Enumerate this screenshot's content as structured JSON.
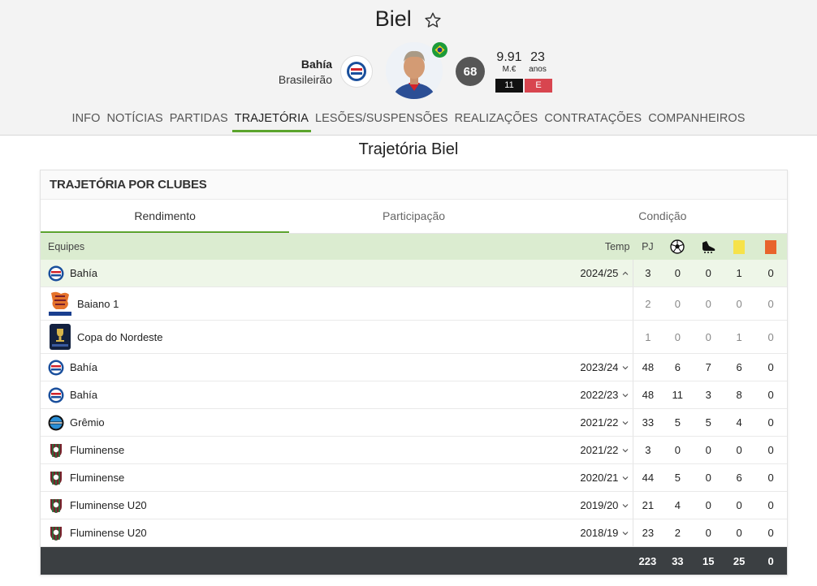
{
  "player": {
    "name": "Biel",
    "team": "Bahía",
    "league": "Brasileirão",
    "rating": "68",
    "value": "9.91",
    "value_unit": "M.€",
    "age": "23",
    "age_unit": "anos",
    "number": "11",
    "shirt_letter": "E"
  },
  "nav": [
    "INFO",
    "NOTÍCIAS",
    "PARTIDAS",
    "TRAJETÓRIA",
    "LESÕES/SUSPENSÕES",
    "REALIZAÇÕES",
    "CONTRATAÇÕES",
    "COMPANHEIROS"
  ],
  "nav_active": 3,
  "section_title": "Trajetória Biel",
  "card_title": "TRAJETÓRIA POR CLUBES",
  "tabs": [
    "Rendimento",
    "Participação",
    "Condição"
  ],
  "headers": {
    "team": "Equipes",
    "season": "Temp",
    "pj": "PJ"
  },
  "rows": [
    {
      "team": "Bahía",
      "season": "2024/25",
      "pj": "3",
      "goals": "0",
      "assists": "0",
      "yellow": "1",
      "red": "0",
      "kind": "club",
      "crest": "bahia",
      "expanded": true
    },
    {
      "team": "Baiano 1",
      "season": "",
      "pj": "2",
      "goals": "0",
      "assists": "0",
      "yellow": "0",
      "red": "0",
      "kind": "comp",
      "crest": "baiano"
    },
    {
      "team": "Copa do Nordeste",
      "season": "",
      "pj": "1",
      "goals": "0",
      "assists": "0",
      "yellow": "1",
      "red": "0",
      "kind": "comp",
      "crest": "nordeste"
    },
    {
      "team": "Bahía",
      "season": "2023/24",
      "pj": "48",
      "goals": "6",
      "assists": "7",
      "yellow": "6",
      "red": "0",
      "kind": "club",
      "crest": "bahia"
    },
    {
      "team": "Bahía",
      "season": "2022/23",
      "pj": "48",
      "goals": "11",
      "assists": "3",
      "yellow": "8",
      "red": "0",
      "kind": "club",
      "crest": "bahia"
    },
    {
      "team": "Grêmio",
      "season": "2021/22",
      "pj": "33",
      "goals": "5",
      "assists": "5",
      "yellow": "4",
      "red": "0",
      "kind": "club",
      "crest": "gremio"
    },
    {
      "team": "Fluminense",
      "season": "2021/22",
      "pj": "3",
      "goals": "0",
      "assists": "0",
      "yellow": "0",
      "red": "0",
      "kind": "club",
      "crest": "fluminense"
    },
    {
      "team": "Fluminense",
      "season": "2020/21",
      "pj": "44",
      "goals": "5",
      "assists": "0",
      "yellow": "6",
      "red": "0",
      "kind": "club",
      "crest": "fluminense"
    },
    {
      "team": "Fluminense U20",
      "season": "2019/20",
      "pj": "21",
      "goals": "4",
      "assists": "0",
      "yellow": "0",
      "red": "0",
      "kind": "club",
      "crest": "fluminense"
    },
    {
      "team": "Fluminense U20",
      "season": "2018/19",
      "pj": "23",
      "goals": "2",
      "assists": "0",
      "yellow": "0",
      "red": "0",
      "kind": "club",
      "crest": "fluminense"
    }
  ],
  "totals": {
    "pj": "223",
    "goals": "33",
    "assists": "15",
    "yellow": "25",
    "red": "0"
  },
  "colors": {
    "accent": "#5ba42c",
    "header_bg": "#dbecd0",
    "yellow_card": "#f6e24a",
    "red_card": "#e8642c"
  },
  "icons": {
    "favorite": "star-outline-icon",
    "goals": "soccer-ball-icon",
    "assists": "boot-icon",
    "expand": "chevron-icon"
  }
}
